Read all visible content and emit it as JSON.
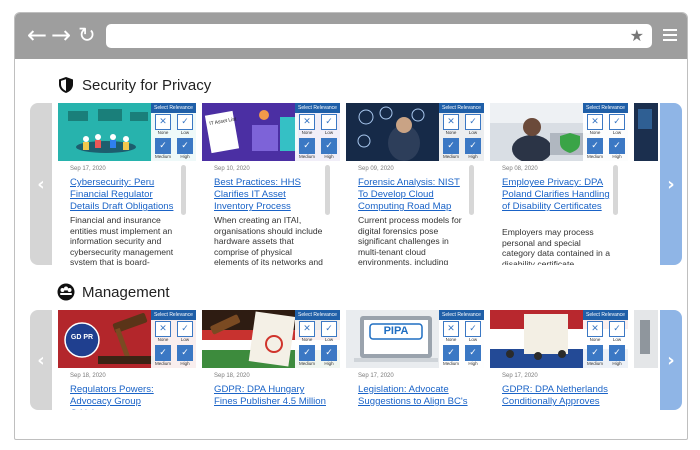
{
  "browser": {
    "back_icon": "back-arrow-icon",
    "forward_icon": "forward-arrow-icon",
    "reload_icon": "reload-icon",
    "url": "",
    "bookmark_icon": "star-icon",
    "menu_icon": "hamburger-menu-icon"
  },
  "relevance_widget": {
    "title": "Select Relevance",
    "options": [
      "None",
      "Low",
      "Medium",
      "High"
    ]
  },
  "sections": [
    {
      "title": "Security for Privacy",
      "icon": "shield-icon",
      "cards": [
        {
          "date": "Sep 17, 2020",
          "title": "Cybersecurity: Peru Financial Regulator Details Draft Obligations",
          "excerpt": "Financial and insurance entities must implement an information security and cybersecurity management system that is board-"
        },
        {
          "date": "Sep 10, 2020",
          "title": "Best Practices: HHS Clarifies IT Asset Inventory Process",
          "excerpt": "When creating an ITAI, organisations should include hardware assets that comprise of physical elements of its networks and"
        },
        {
          "date": "Sep 09, 2020",
          "title": "Forensic Analysis: NIST To Develop Cloud Computing Road Map",
          "excerpt": "Current process models for digital forensics pose significant challenges in multi-tenant cloud environments, including architecture"
        },
        {
          "date": "Sep 08, 2020",
          "title": "Employee Privacy: DPA Poland Clarifies Handling of Disability Certificates",
          "excerpt": "Employers may process personal and special category data contained in a disability certificate voluntarily provided in either"
        }
      ]
    },
    {
      "title": "Management",
      "icon": "people-group-icon",
      "cards": [
        {
          "date": "Sep 18, 2020",
          "title": "Regulators Powers: Advocacy Group Criticizes",
          "excerpt": "",
          "image_text": "GD PR"
        },
        {
          "date": "Sep 18, 2020",
          "title": "GDPR: DPA Hungary Fines Publisher 4.5 Million",
          "excerpt": ""
        },
        {
          "date": "Sep 17, 2020",
          "title": "Legislation: Advocate Suggestions to Align BC's",
          "excerpt": "",
          "image_text": "PIPA"
        },
        {
          "date": "Sep 17, 2020",
          "title": "GDPR: DPA Netherlands Conditionally Approves",
          "excerpt": ""
        }
      ]
    }
  ],
  "colors": {
    "chrome": "#9e9e9e",
    "link": "#1a63c7",
    "accent": "#3b78c4",
    "next_arrow": "#8fb5e6"
  }
}
